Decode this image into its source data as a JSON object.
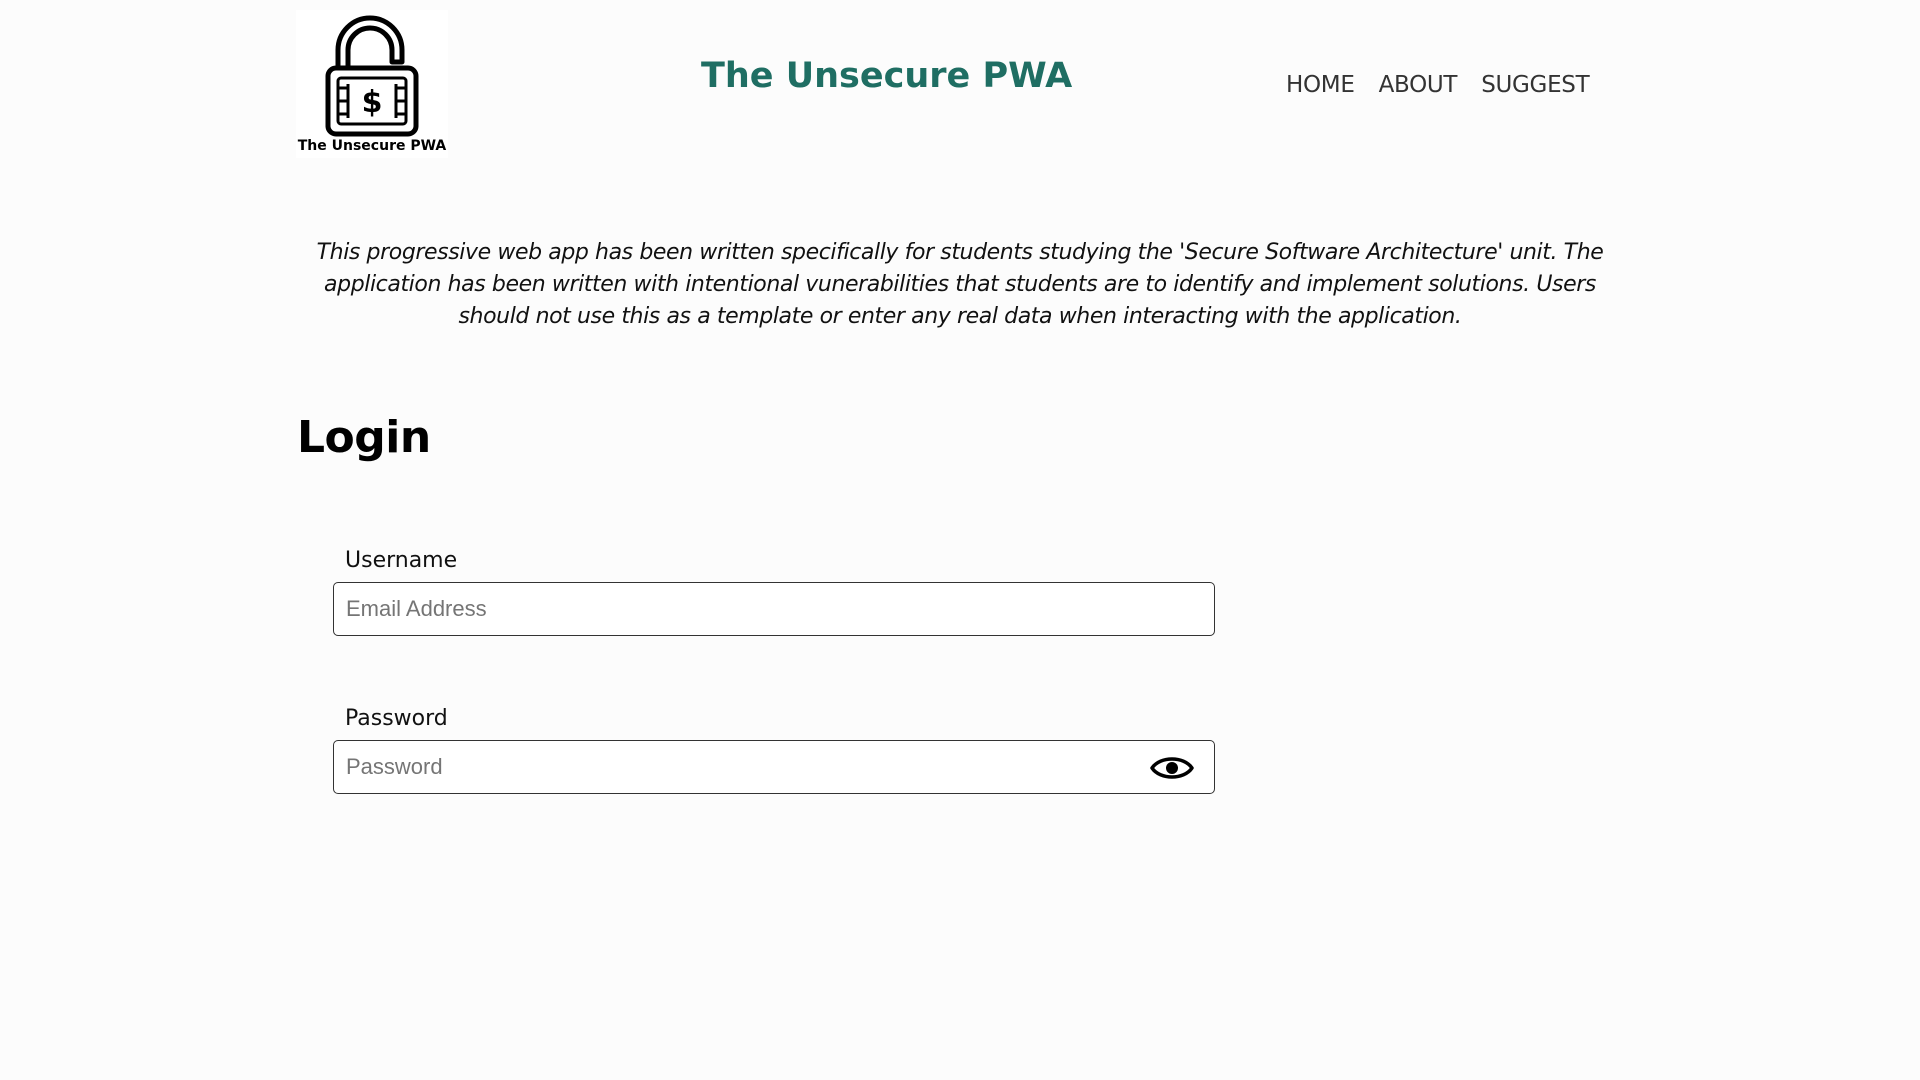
{
  "header": {
    "logo_caption": "The Unsecure PWA",
    "site_title": "The Unsecure PWA",
    "nav": [
      {
        "label": "HOME"
      },
      {
        "label": "ABOUT"
      },
      {
        "label": "SUGGEST"
      }
    ]
  },
  "intro": {
    "text": "This progressive web app has been written specifically for students studying the 'Secure Software Architecture' unit. The application has been written with intentional vunerabilities that students are to identify and implement solutions. Users should not use this as a template or enter any real data when interacting with the application."
  },
  "login": {
    "heading": "Login",
    "username_label": "Username",
    "username_placeholder": "Email Address",
    "username_value": "",
    "password_label": "Password",
    "password_placeholder": "Password",
    "password_value": "",
    "toggle_icon": "eye-icon"
  },
  "colors": {
    "title": "#1f6e63",
    "background": "#fcfcfc"
  }
}
